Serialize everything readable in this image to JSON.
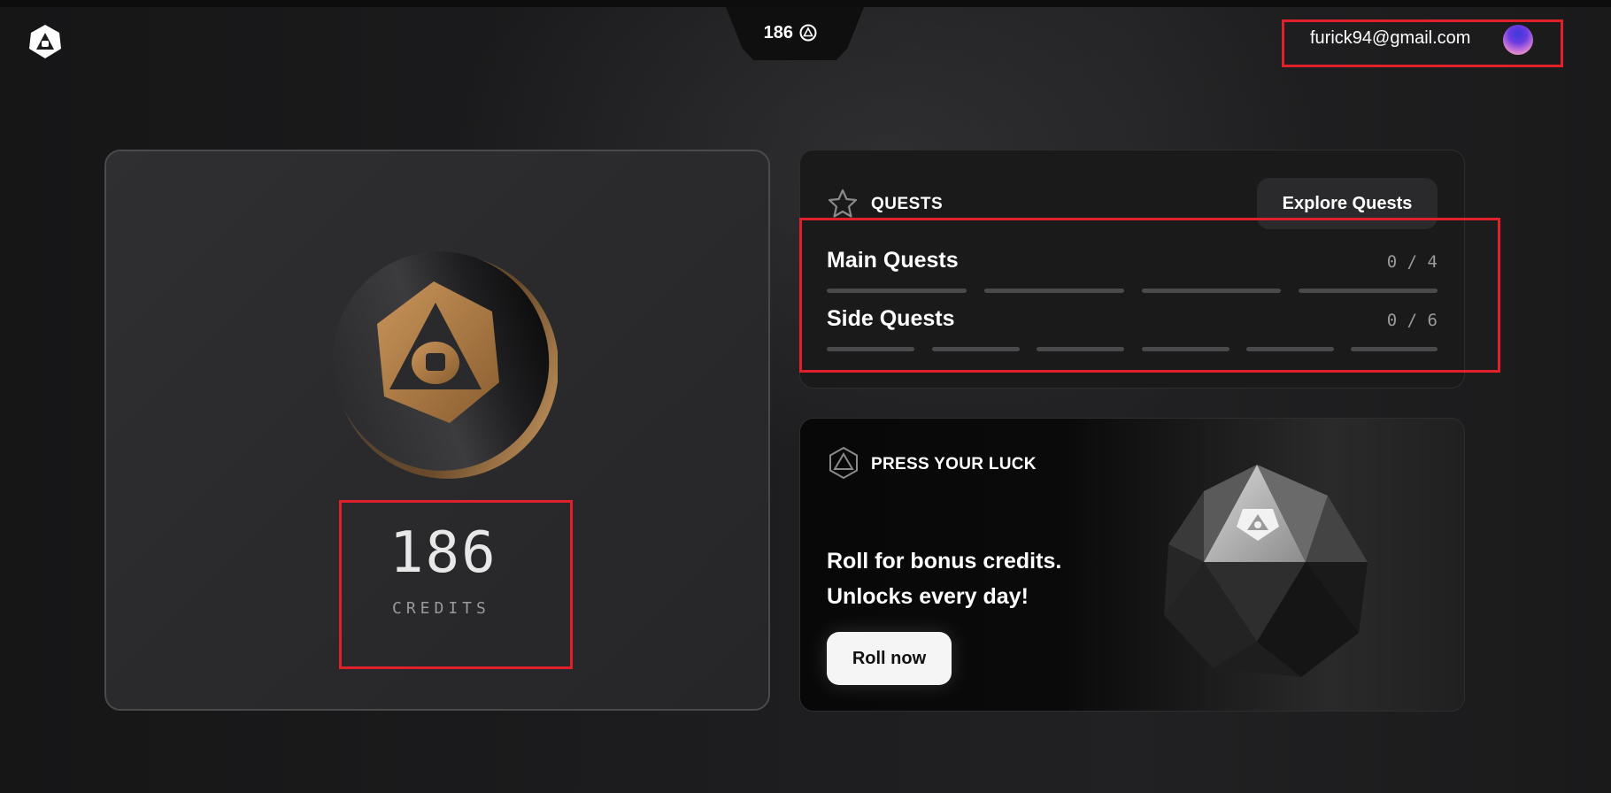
{
  "header": {
    "credit_balance": "186",
    "user_email": "furick94@gmail.com"
  },
  "credits_card": {
    "amount": "186",
    "label": "CREDITS"
  },
  "quests": {
    "title": "QUESTS",
    "explore_label": "Explore Quests",
    "main": {
      "label": "Main Quests",
      "count": "0 / 4",
      "completed": 0,
      "total": 4
    },
    "side": {
      "label": "Side Quests",
      "count": "0 / 6",
      "completed": 0,
      "total": 6
    }
  },
  "luck": {
    "title": "PRESS YOUR LUCK",
    "line1": "Roll for bonus credits.",
    "line2": "Unlocks every day!",
    "button_label": "Roll now"
  },
  "icons": {
    "logo": "brand-logo-icon",
    "balance": "credit-coin-icon",
    "quests": "star-icon",
    "luck": "d20-outline-icon"
  },
  "colors": {
    "highlight": "#e0202a",
    "coin_gold": "#b98547",
    "bar_inactive": "#4a4a4d"
  }
}
